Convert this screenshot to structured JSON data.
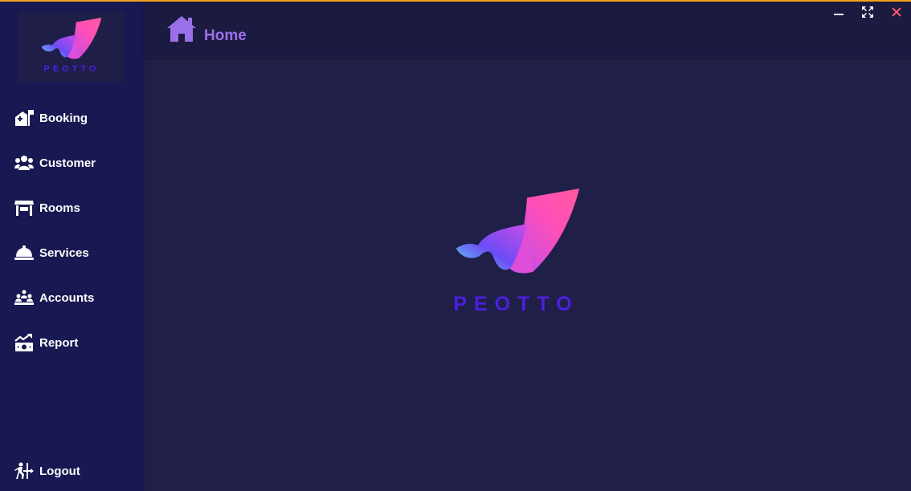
{
  "app": {
    "brand": "PEOTTO",
    "accent": "#f2a31a",
    "sidebar_bg": "#181852",
    "main_bg": "#1f1f47"
  },
  "header": {
    "title": "Home",
    "icon": "home-icon",
    "title_color": "#9b6fe8"
  },
  "window_controls": [
    {
      "name": "minimize",
      "icon": "minimize-icon"
    },
    {
      "name": "maximize",
      "icon": "maximize-icon"
    },
    {
      "name": "close",
      "icon": "close-icon"
    }
  ],
  "sidebar": {
    "logo_text": "PEOTTO",
    "items": [
      {
        "label": "Booking",
        "icon": "hotel-icon"
      },
      {
        "label": "Customer",
        "icon": "users-icon"
      },
      {
        "label": "Rooms",
        "icon": "store-icon"
      },
      {
        "label": "Services",
        "icon": "bell-icon"
      },
      {
        "label": "Accounts",
        "icon": "team-icon"
      },
      {
        "label": "Report",
        "icon": "chart-money-icon"
      }
    ],
    "logout_label": "Logout",
    "logout_icon": "logout-icon"
  },
  "main": {
    "logo_text": "PEOTTO"
  }
}
